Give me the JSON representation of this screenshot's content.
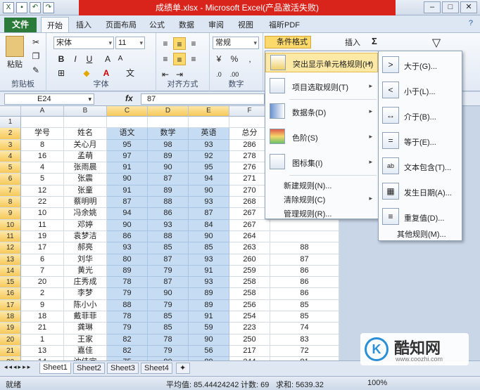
{
  "window": {
    "title": "成绩单.xlsx - Microsoft Excel(产品激活失败)"
  },
  "ribbon_tabs": [
    "文件",
    "开始",
    "插入",
    "页面布局",
    "公式",
    "数据",
    "审阅",
    "视图",
    "福昕PDF"
  ],
  "ribbon": {
    "paste": "粘贴",
    "font_name": "宋体",
    "font_size": "11",
    "number_format": "常规",
    "cond_format": "条件格式",
    "insert": "插入",
    "sigma": "Σ",
    "groups": [
      "剪贴板",
      "字体",
      "对齐方式",
      "数字"
    ]
  },
  "formula_bar": {
    "name_box": "E24",
    "fx": "fx",
    "value": "87"
  },
  "columns": [
    "A",
    "B",
    "C",
    "D",
    "E",
    "F"
  ],
  "headers": [
    "学号",
    "姓名",
    "语文",
    "数学",
    "英语",
    "总分"
  ],
  "rows": [
    [
      "8",
      "关心月",
      "95",
      "98",
      "93",
      "286"
    ],
    [
      "16",
      "孟萌",
      "97",
      "89",
      "92",
      "278"
    ],
    [
      "4",
      "张雨晨",
      "91",
      "90",
      "95",
      "276"
    ],
    [
      "5",
      "张震",
      "90",
      "87",
      "94",
      "271"
    ],
    [
      "12",
      "张童",
      "91",
      "89",
      "90",
      "270"
    ],
    [
      "22",
      "蔡明明",
      "87",
      "88",
      "93",
      "268"
    ],
    [
      "10",
      "冯余姚",
      "94",
      "86",
      "87",
      "267"
    ],
    [
      "11",
      "邓婷",
      "90",
      "93",
      "84",
      "267"
    ],
    [
      "19",
      "袁梦洁",
      "86",
      "88",
      "90",
      "264"
    ],
    [
      "17",
      "郝亮",
      "93",
      "85",
      "85",
      "263"
    ],
    [
      "6",
      "刘华",
      "80",
      "87",
      "93",
      "260"
    ],
    [
      "7",
      "黄光",
      "89",
      "79",
      "91",
      "259"
    ],
    [
      "20",
      "庄秀成",
      "78",
      "87",
      "93",
      "258"
    ],
    [
      "2",
      "李梦",
      "79",
      "90",
      "89",
      "258"
    ],
    [
      "9",
      "陈小小",
      "88",
      "79",
      "89",
      "256"
    ],
    [
      "18",
      "戴菲菲",
      "78",
      "85",
      "91",
      "254"
    ],
    [
      "21",
      "龚琳",
      "79",
      "85",
      "59",
      "223"
    ],
    [
      "1",
      "王家",
      "82",
      "78",
      "90",
      "250"
    ],
    [
      "13",
      "嘉佳",
      "82",
      "79",
      "56",
      "217"
    ],
    [
      "14",
      "沈佳宜",
      "75",
      "80",
      "89",
      "244"
    ],
    [
      "15",
      "陆遥",
      "50",
      "80",
      "89",
      "219"
    ],
    [
      "3",
      "张飞",
      "66",
      "79",
      "87",
      "232"
    ]
  ],
  "extra_col": {
    "label_rows": [
      10,
      11,
      12,
      13,
      14,
      15,
      16,
      17,
      18,
      19,
      20,
      21,
      22,
      23
    ],
    "values": [
      "88",
      "87",
      "86",
      "86",
      "86",
      "85",
      "85",
      "74",
      "83",
      "72",
      "81",
      "73",
      "77"
    ]
  },
  "menu": {
    "items": [
      {
        "label": "突出显示单元格规则(H)",
        "arrow": "▸"
      },
      {
        "label": "项目选取规则(T)",
        "arrow": "▸"
      },
      {
        "label": "数据条(D)",
        "arrow": "▸"
      },
      {
        "label": "色阶(S)",
        "arrow": "▸"
      },
      {
        "label": "图标集(I)",
        "arrow": "▸"
      }
    ],
    "actions": [
      "新建规则(N)...",
      "清除规则(C)",
      "管理规则(R)..."
    ],
    "clear_arrow": "▸"
  },
  "submenu": {
    "items": [
      "大于(G)...",
      "小于(L)...",
      "介于(B)...",
      "等于(E)...",
      "文本包含(T)...",
      "发生日期(A)...",
      "重复值(D)..."
    ],
    "more": "其他规则(M)..."
  },
  "sheets": [
    "Sheet1",
    "Sheet2",
    "Sheet3",
    "Sheet4"
  ],
  "status": {
    "ready": "就绪",
    "avg": "平均值: 85.44424242",
    "count": "计数: 69",
    "sum": "求和: 5639.32",
    "zoom": "100%"
  },
  "watermark": {
    "brand": "酷知网",
    "url": "www.coozhi.com"
  }
}
